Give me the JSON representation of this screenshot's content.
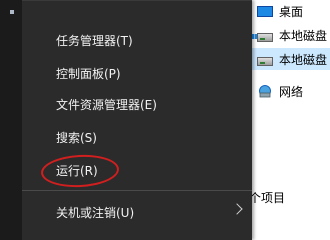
{
  "explorer": {
    "nav": [
      {
        "label": "桌面",
        "icon": "desktop-icon"
      },
      {
        "label": "本地磁盘",
        "icon": "drive-icon"
      },
      {
        "label": "本地磁盘",
        "icon": "drive-icon"
      },
      {
        "label": "网络",
        "icon": "network-icon"
      }
    ],
    "footer_count": "个项目"
  },
  "menu": {
    "items": [
      {
        "label": "任务管理器(T)"
      },
      {
        "label": "控制面板(P)"
      },
      {
        "label": "文件资源管理器(E)"
      },
      {
        "label": "搜索(S)"
      },
      {
        "label": "运行(R)"
      },
      {
        "label": "关机或注销(U)",
        "submenu_icon": "chevron-right-icon"
      }
    ],
    "annotation_color": "#d11f1f",
    "background": "#2b2b2b"
  }
}
